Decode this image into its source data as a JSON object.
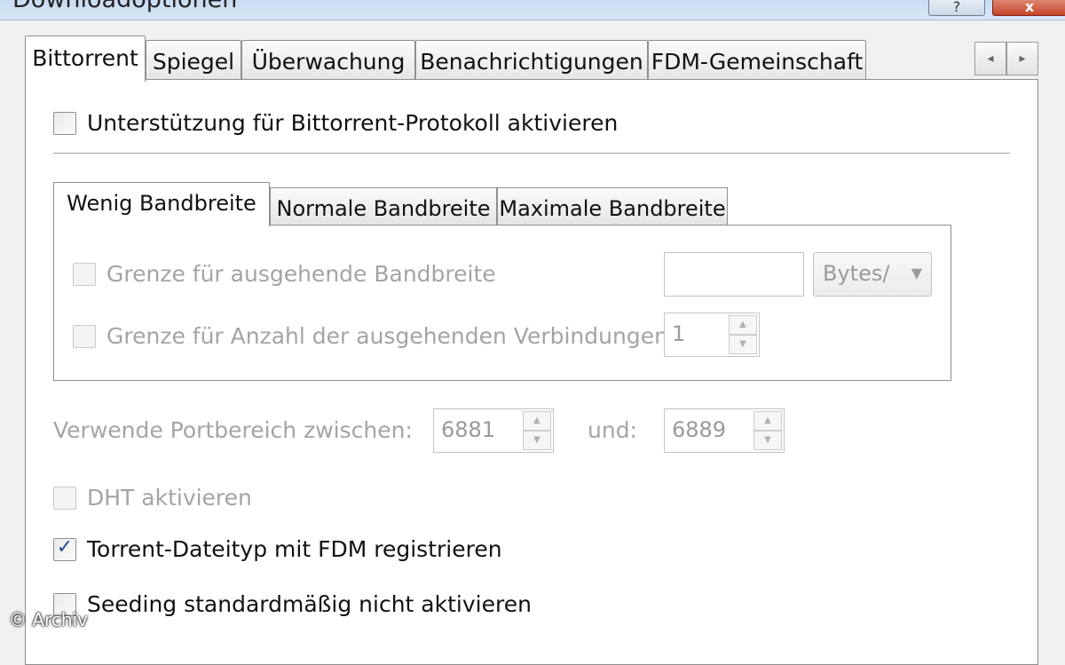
{
  "window": {
    "title": "Downloadoptionen",
    "help_glyph": "?",
    "close_glyph": "x"
  },
  "outer_tabs": [
    {
      "label": "Bittorrent",
      "active": true
    },
    {
      "label": "Spiegel",
      "active": false
    },
    {
      "label": "Überwachung",
      "active": false
    },
    {
      "label": "Benachrichtigungen",
      "active": false
    },
    {
      "label": "FDM-Gemeinschaft",
      "active": false
    }
  ],
  "tab_scroll": {
    "left_glyph": "◂",
    "right_glyph": "▸"
  },
  "bittorrent": {
    "enable_label": "Unterstützung für Bittorrent-Protokoll aktivieren",
    "enable_checked": false,
    "bandwidth_tabs": [
      {
        "label": "Wenig Bandbreite",
        "active": true
      },
      {
        "label": "Normale Bandbreite",
        "active": false
      },
      {
        "label": "Maximale Bandbreite",
        "active": false
      }
    ],
    "outgoing_limit_label": "Grenze für ausgehende Bandbreite",
    "outgoing_limit_value": "",
    "outgoing_limit_unit": "Bytes/",
    "connections_limit_label": "Grenze für Anzahl der ausgehenden Verbindungen",
    "connections_limit_value": "1",
    "port_range_label": "Verwende Portbereich zwischen:",
    "port_from": "6881",
    "port_and_label": "und:",
    "port_to": "6889",
    "dht_label": "DHT aktivieren",
    "dht_checked": false,
    "register_label": "Torrent-Dateityp mit FDM registrieren",
    "register_checked": true,
    "register_check_glyph": "✓",
    "seeding_label": "Seeding standardmäßig nicht aktivieren",
    "seeding_checked": false
  },
  "watermark": "© Archiv",
  "icons": {
    "spin_up": "▲",
    "spin_down": "▼",
    "dropdown": "▼"
  }
}
